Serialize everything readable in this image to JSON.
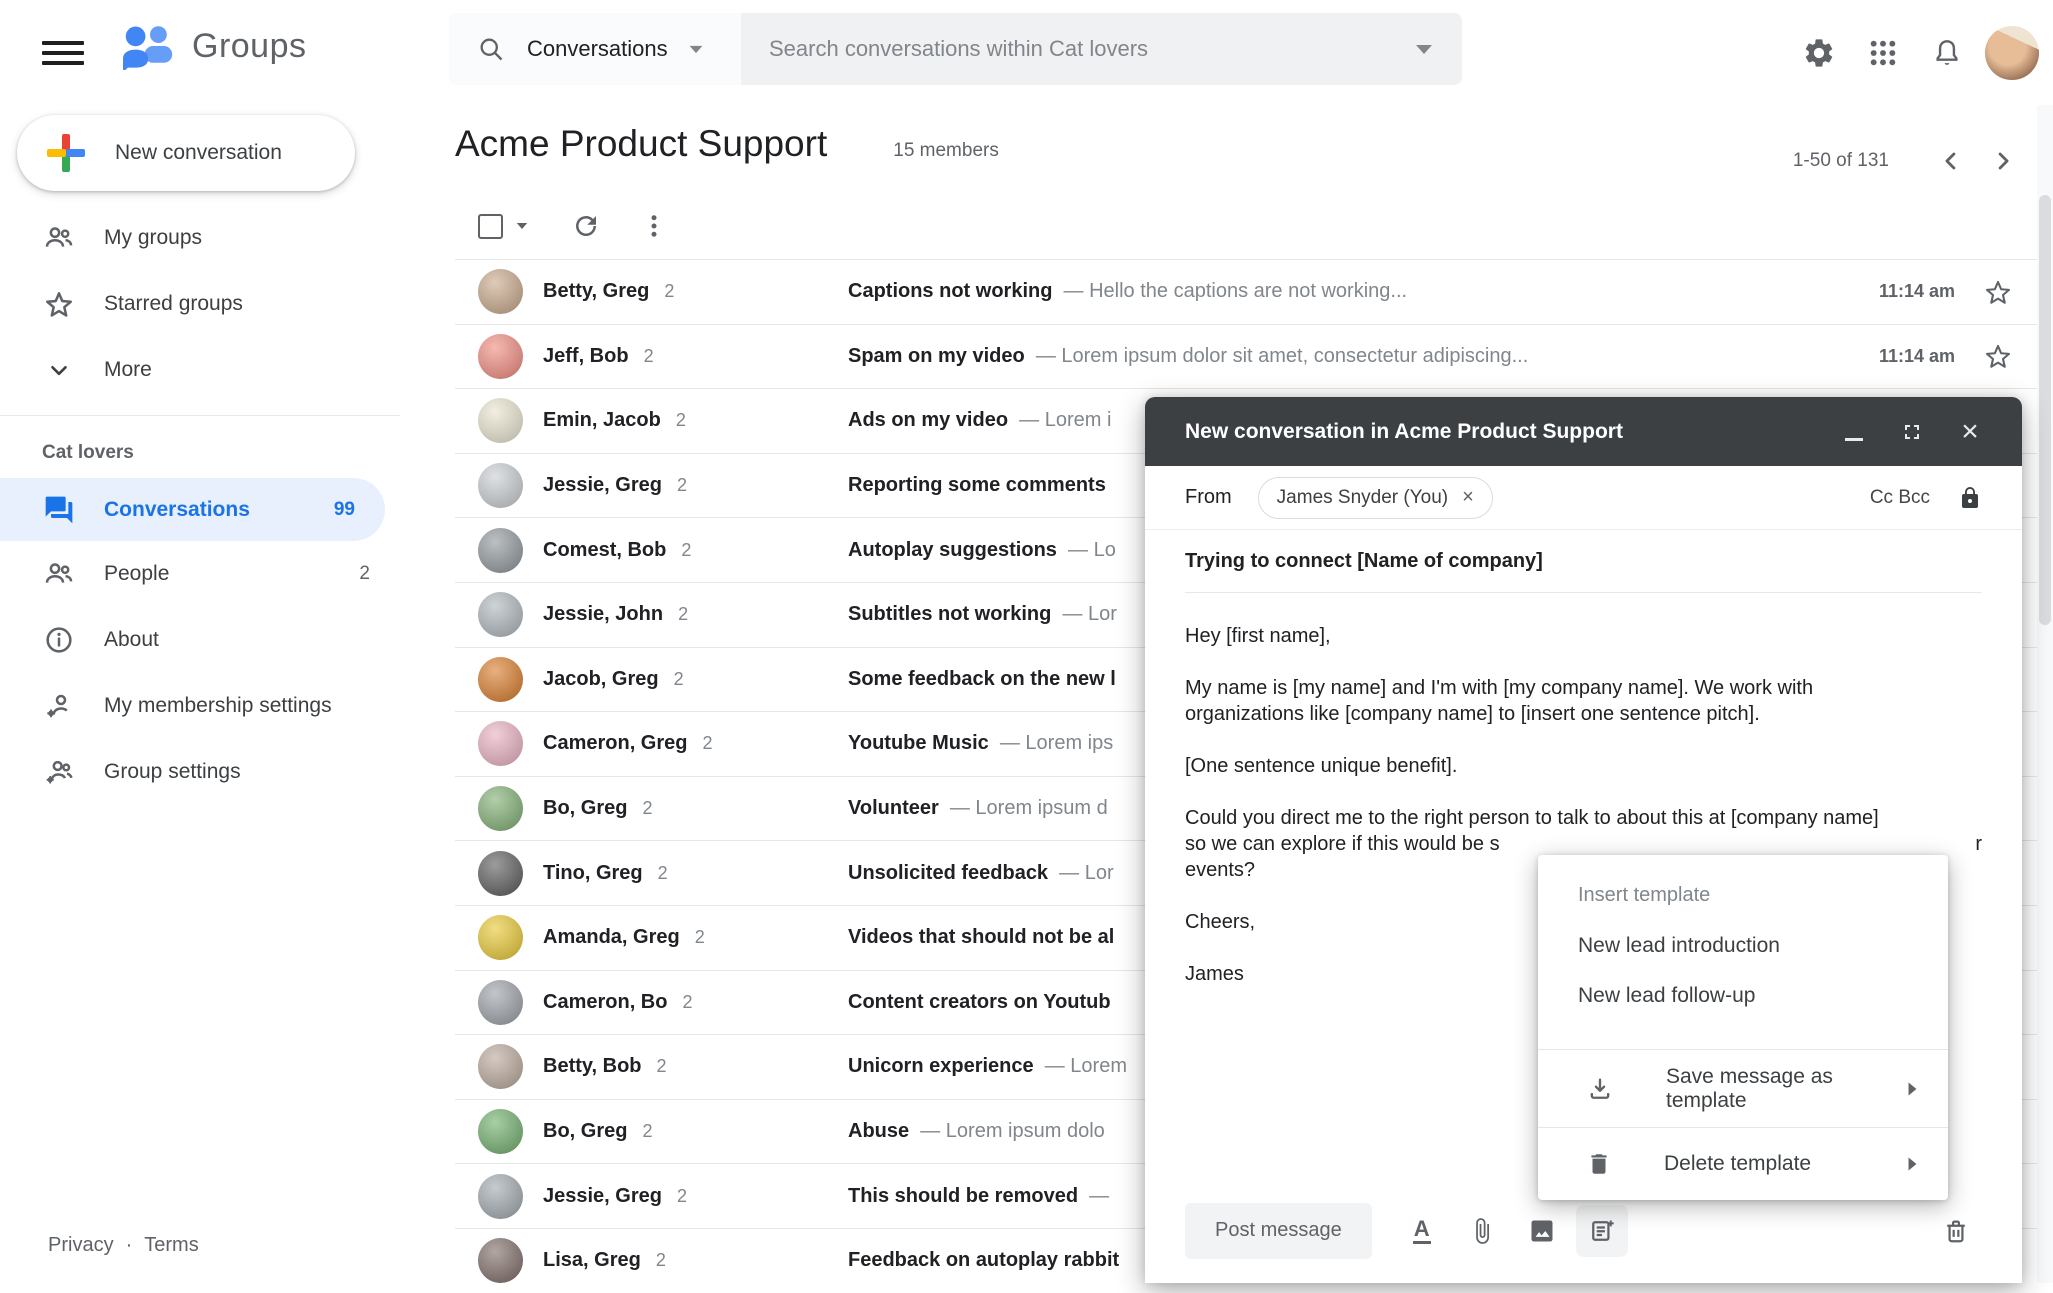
{
  "colors": {
    "accent": "#1a73e8",
    "active_bg": "#e8f0fe",
    "dialog_header": "#3c4043",
    "text_primary": "#202124",
    "text_secondary": "#5f6368",
    "search_bg": "#f0f1f3",
    "button_bg": "#f1f3f4"
  },
  "topbar": {
    "product": "Groups",
    "search": {
      "scope": "Conversations",
      "placeholder": "Search conversations within Cat lovers"
    }
  },
  "sidebar": {
    "new_conversation": "New conversation",
    "items": [
      {
        "label": "My groups"
      },
      {
        "label": "Starred groups"
      },
      {
        "label": "More"
      }
    ],
    "section": {
      "title": "Cat lovers",
      "items": [
        {
          "label": "Conversations",
          "count": "99",
          "active": true
        },
        {
          "label": "People",
          "count": "2"
        },
        {
          "label": "About",
          "count": ""
        },
        {
          "label": "My membership settings",
          "count": ""
        },
        {
          "label": "Group settings",
          "count": ""
        }
      ]
    },
    "footer": {
      "privacy": "Privacy",
      "separator": "·",
      "terms": "Terms"
    }
  },
  "main": {
    "title": "Acme Product Support",
    "members": "15 members",
    "pagination": "1-50 of 131",
    "rows": [
      {
        "names": "Betty, Greg",
        "count": "2",
        "subject": "Captions not working",
        "preview": "Hello the captions are not working...",
        "time": "11:14 am",
        "starred": false,
        "avatar": "#c8a88a"
      },
      {
        "names": "Jeff, Bob",
        "count": "2",
        "subject": "Spam on my video",
        "preview": "Lorem ipsum dolor sit amet, consectetur adipiscing...",
        "time": "11:14 am",
        "starred": false,
        "avatar": "#f08a7e"
      },
      {
        "names": "Emin, Jacob",
        "count": "2",
        "subject": "Ads on my video",
        "preview": "Lorem i",
        "time": "",
        "starred": false,
        "avatar": "#e9e4cf"
      },
      {
        "names": "Jessie, Greg",
        "count": "2",
        "subject": "Reporting some comments",
        "preview": null,
        "time": "",
        "starred": false,
        "avatar": "#c9cdd1"
      },
      {
        "names": "Comest, Bob",
        "count": "2",
        "subject": "Autoplay suggestions",
        "preview": "Lo",
        "time": "",
        "starred": false,
        "avatar": "#8f969b"
      },
      {
        "names": "Jessie, John",
        "count": "2",
        "subject": "Subtitles not working",
        "preview": "Lor",
        "time": "",
        "starred": false,
        "avatar": "#aeb6bb"
      },
      {
        "names": "Jacob, Greg",
        "count": "2",
        "subject": "Some feedback on the new l",
        "preview": null,
        "time": "",
        "starred": false,
        "avatar": "#d97b29"
      },
      {
        "names": "Cameron, Greg",
        "count": "2",
        "subject": "Youtube Music",
        "preview": "Lorem ips",
        "time": "",
        "starred": false,
        "avatar": "#e8b0c0"
      },
      {
        "names": "Bo, Greg",
        "count": "2",
        "subject": "Volunteer",
        "preview": "Lorem ipsum d",
        "time": "",
        "starred": false,
        "avatar": "#7fae72"
      },
      {
        "names": "Tino, Greg",
        "count": "2",
        "subject": "Unsolicited feedback",
        "preview": "Lor",
        "time": "",
        "starred": false,
        "avatar": "#5a5a5a"
      },
      {
        "names": "Amanda, Greg",
        "count": "2",
        "subject": "Videos that should not be al",
        "preview": null,
        "time": "",
        "starred": false,
        "avatar": "#e8c832"
      },
      {
        "names": "Cameron, Bo",
        "count": "2",
        "subject": "Content creators on Youtub",
        "preview": null,
        "time": "",
        "starred": false,
        "avatar": "#9aa0a6"
      },
      {
        "names": "Betty, Bob",
        "count": "2",
        "subject": "Unicorn experience",
        "preview": "Lorem",
        "time": "",
        "starred": false,
        "avatar": "#b9a79a"
      },
      {
        "names": "Bo, Greg",
        "count": "2",
        "subject": "Abuse",
        "preview": "Lorem ipsum dolo",
        "time": "",
        "starred": false,
        "avatar": "#6fae6a"
      },
      {
        "names": "Jessie, Greg",
        "count": "2",
        "subject": "This should be removed",
        "preview": "",
        "time": "",
        "starred": false,
        "avatar": "#9fa8ad"
      },
      {
        "names": "Lisa, Greg",
        "count": "2",
        "subject": "Feedback on autoplay rabbit",
        "preview": null,
        "time": "",
        "starred": false,
        "avatar": "#7d6b66"
      }
    ]
  },
  "dialog": {
    "title": "New conversation in Acme Product Support",
    "from_label": "From",
    "from_chip": "James Snyder (You)",
    "chip_remove": "×",
    "cc_bcc": "Cc Bcc",
    "subject": "Trying to connect [Name of company]",
    "body": {
      "p1": "Hey [first name],",
      "p2a": "My name is [my name] and I'm with [my company name]. We work with",
      "p2b": "organizations like [company name] to [insert one sentence pitch].",
      "p3": "[One sentence unique benefit].",
      "p4a": "Could you direct me to the right person to talk to about this at [company name]",
      "p4b_left": "so we can explore if this would be s",
      "p4b_right": "r",
      "p4c": "events?",
      "p5": "Cheers,",
      "p6": "James"
    },
    "post_label": "Post message",
    "close_label": "×"
  },
  "menu": {
    "header": "Insert template",
    "items": [
      {
        "label": "New lead introduction"
      },
      {
        "label": "New lead follow-up"
      }
    ],
    "save_label": "Save message as template",
    "delete_label": "Delete template"
  }
}
